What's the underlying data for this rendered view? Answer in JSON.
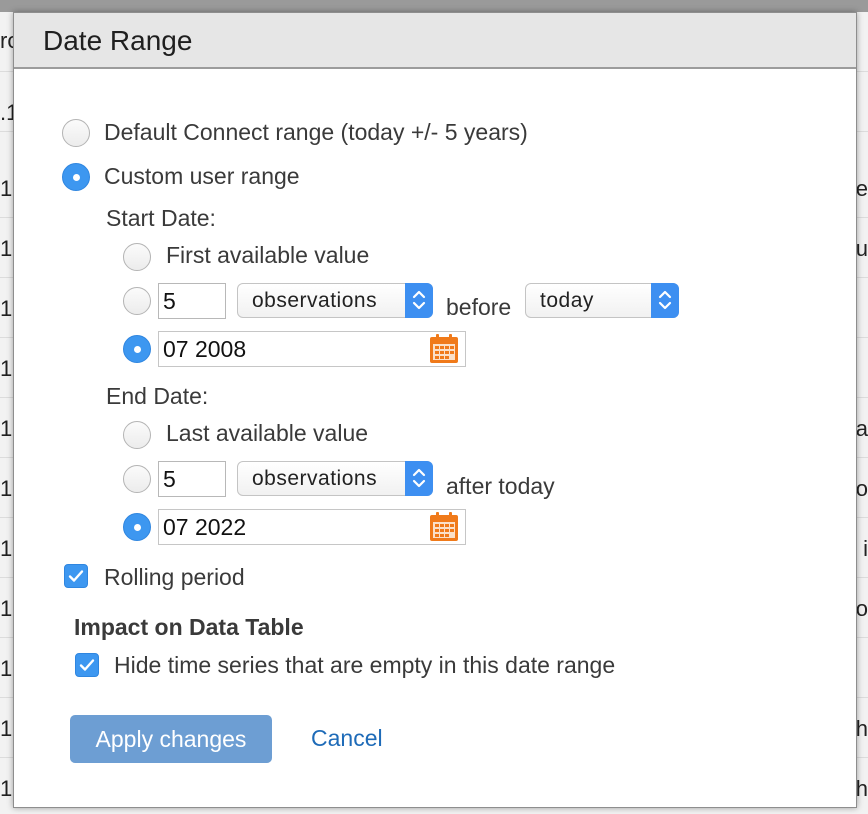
{
  "background": {
    "left_chars": [
      "ro",
      ".1",
      "1",
      "1",
      "1",
      "1",
      "1",
      "1",
      "1",
      "1",
      "1",
      "1",
      "1"
    ],
    "right_chars": [
      "e",
      "u",
      "a",
      "o",
      "i",
      "o",
      "h",
      "h"
    ]
  },
  "dialog": {
    "title": "Date Range",
    "range_options": {
      "default_label": "Default Connect range (today +/- 5 years)",
      "custom_label": "Custom user range",
      "selected": "custom"
    },
    "start_date": {
      "heading": "Start Date:",
      "first_available_label": "First available value",
      "count_value": "5",
      "unit_value": "observations",
      "before_label": "before",
      "anchor_value": "today",
      "date_value": "07 2008",
      "selected": "date"
    },
    "end_date": {
      "heading": "End Date:",
      "last_available_label": "Last available value",
      "count_value": "5",
      "unit_value": "observations",
      "after_label": "after today",
      "date_value": "07 2022",
      "selected": "date"
    },
    "rolling_period": {
      "label": "Rolling period",
      "checked": true
    },
    "impact": {
      "heading": "Impact on Data Table",
      "hide_empty_label": "Hide time series that are empty in this date range",
      "checked": true
    },
    "buttons": {
      "apply_label": "Apply changes",
      "cancel_label": "Cancel"
    }
  },
  "colors": {
    "accent": "#3d97f0",
    "apply_button": "#6d9ed3",
    "link": "#1e6bb8",
    "calendar_icon": "#f07a1a"
  }
}
